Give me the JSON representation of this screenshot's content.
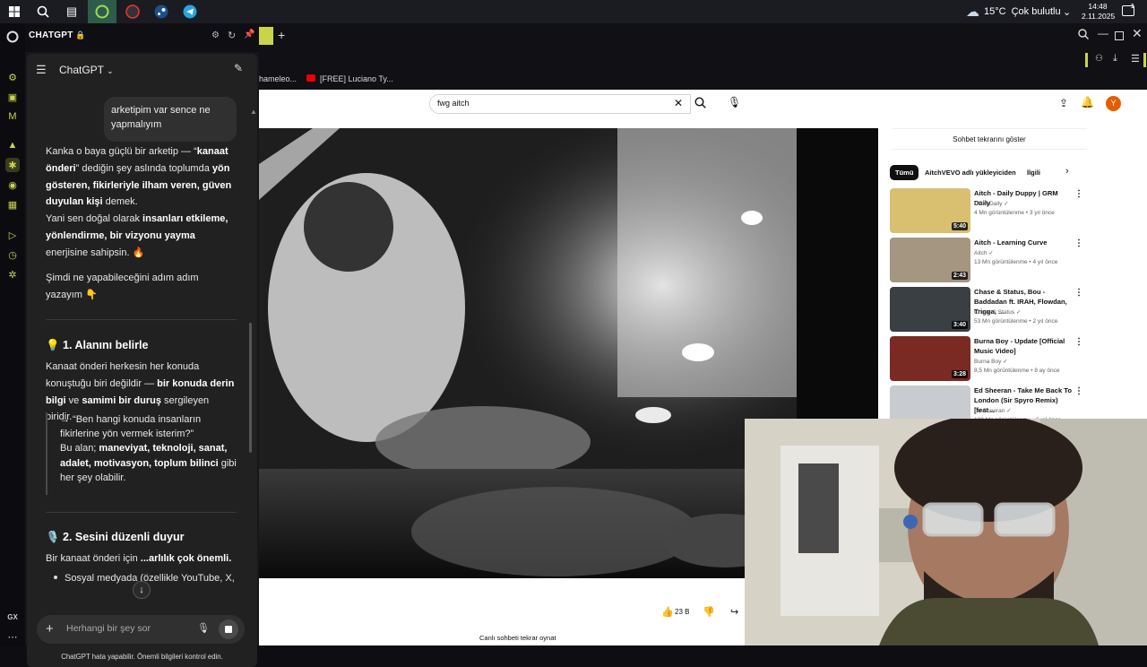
{
  "taskbar": {
    "weather_temp": "15°C",
    "weather_text": "Çok bulutlu",
    "time": "14:48",
    "date": "2.11.2025",
    "notification_count": "1"
  },
  "browser": {
    "tab_add": "+",
    "bookmarks": [
      "hameleo...",
      "[FREE] Luciano Ty..."
    ]
  },
  "chat": {
    "app_title": "CHATGPT",
    "model_label": "ChatGPT",
    "user_message": "arketipim var sence ne yapmalıyım",
    "para1_a": "Kanka o baya güçlü bir arketip — “",
    "para1_b": "kanaat önderi",
    "para1_c": "” dediğin şey aslında toplumda ",
    "para1_d": "yön gösteren, fikirleriyle ilham veren, güven duyulan kişi",
    "para1_e": " demek.",
    "para2_a": "Yani sen doğal olarak ",
    "para2_b": "insanları etkileme, yönlendirme, bir vizyonu yayma",
    "para2_c": " enerjisine sahipsin. 🔥",
    "para3": "Şimdi ne yapabileceğini adım adım yazayım 👇",
    "h1": "💡 1. Alanını belirle",
    "sec1_a": "Kanaat önderi herkesin her konuda konuştuğu biri değildir — ",
    "sec1_b": "bir konuda derin bilgi",
    "sec1_c": " ve ",
    "sec1_d": "samimi bir duruş",
    "sec1_e": " sergileyen biridir.",
    "quote_a": "→ “Ben hangi konuda insanların fikirlerine yön vermek isterim?”",
    "quote_b": "Bu alan; ",
    "quote_c": "maneviyat, teknoloji, sanat, adalet, motivasyon, toplum bilinci",
    "quote_d": " gibi her şey olabilir.",
    "h2": "🎙️ 2. Sesini düzenli duyur",
    "sec2_a": "Bir kanaat önderi için ",
    "sec2_b": "...arlılık çok önemli.",
    "bullet1": "Sosyal medyada (özellikle YouTube, X,",
    "input_placeholder": "Herhangi bir şey sor",
    "disclaimer": "ChatGPT hata yapabilir. Önemli bilgileri kontrol edin."
  },
  "youtube": {
    "search_value": "fwg aitch",
    "avatar_letter": "Y",
    "chat_replay": "Sohbet tekrarını göster",
    "chips": [
      "Tümü",
      "AitchVEVO adlı yükleyiciden",
      "İlgili"
    ],
    "likes": "23 B",
    "live_replay": "Canlı sohbeti tekrar oynat",
    "recommendations": [
      {
        "title": "Aitch - Daily Duppy | GRM Daily",
        "channel": "GRM Daily",
        "meta": "4 Mn görüntülenme • 3 yıl önce",
        "duration": "5:40",
        "color": "#d8c070"
      },
      {
        "title": "Aitch - Learning Curve",
        "channel": "Aitch",
        "meta": "13 Mn görüntülenme • 4 yıl önce",
        "duration": "2:43",
        "color": "#a49680"
      },
      {
        "title": "Chase & Status, Bou - Baddadan ft. IRAH, Flowdan, Trigga, ...",
        "channel": "Chase & Status",
        "meta": "53 Mn görüntülenme • 2 yıl önce",
        "duration": "3:40",
        "color": "#3a3f44"
      },
      {
        "title": "Burna Boy - Update [Official Music Video]",
        "channel": "Burna Boy",
        "meta": "8,5 Mn görüntülenme • 8 ay önce",
        "duration": "3:28",
        "color": "#7a2a22"
      },
      {
        "title": "Ed Sheeran - Take Me Back To London (Sir Spyro Remix) [feat...",
        "channel": "Ed Sheeran",
        "meta": "128 Mn görüntülenme • 6 yıl önce",
        "duration": "",
        "color": "#c8ccd0"
      }
    ]
  }
}
